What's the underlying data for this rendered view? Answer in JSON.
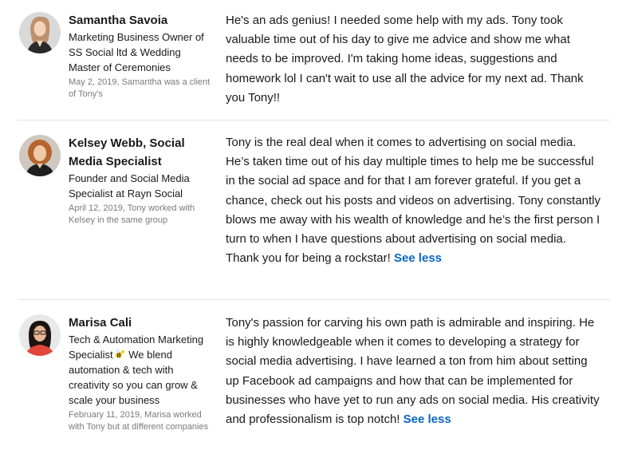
{
  "recommendations": [
    {
      "name": "Samantha Savoia",
      "headline": "Marketing Business Owner of SS Social ltd & Wedding Master of Ceremonies",
      "meta": "May 2, 2019, Samantha was a client of Tony's",
      "text": "He's an ads genius! I needed some help with my ads. Tony took valuable time out of his day to give me advice and show me what needs to be improved. I'm taking home ideas, suggestions and homework lol I can't wait to use all the advice for my next ad. Thank you Tony!!",
      "see_label": ""
    },
    {
      "name": "Kelsey Webb, Social Media Specialist",
      "headline": "Founder and Social Media Specialist at Rayn Social",
      "meta": "April 12, 2019, Tony worked with Kelsey in the same group",
      "text": "Tony is the real deal when it comes to advertising on social media. He’s taken time out of his day multiple times to help me be successful in the social ad space and for that I am forever grateful. If you get a chance, check out his posts and videos on advertising. Tony constantly blows me away with his wealth of knowledge and he’s the first person I turn to when I have questions about advertising on social media. Thank you for being a rockstar!",
      "see_label": "See less"
    },
    {
      "name": "Marisa Cali",
      "headline_part1": "Tech & Automation Marketing Specialist",
      "headline_part2": " We blend automation & tech with creativity so you can grow & scale your business",
      "meta": "February 11, 2019, Marisa worked with Tony but at different companies",
      "text": "Tony's passion for carving his own path is admirable and inspiring. He is highly knowledgeable when it comes to developing a strategy for social media advertising. I have learned a ton from him about setting up Facebook ad campaigns and how that can be implemented for businesses who have yet to run any ads on social media. His creativity and professionalism is top notch!",
      "see_label": "See less"
    }
  ],
  "icons": {
    "headline_emoji": "bee-sparkle-icon"
  },
  "colors": {
    "link": "#0a66c2",
    "meta": "#7a7a7a",
    "divider": "#e3e3e3"
  }
}
